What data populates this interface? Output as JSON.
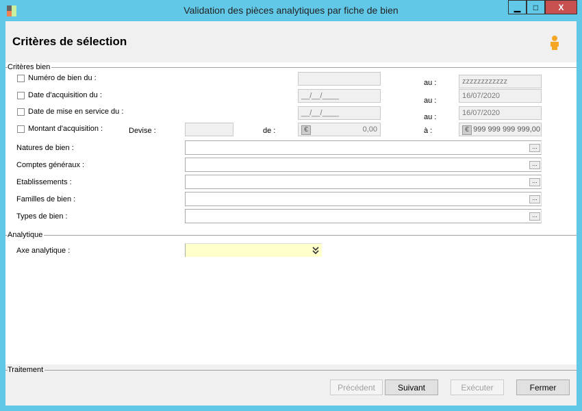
{
  "window": {
    "title": "Validation des pièces analytiques par fiche de bien",
    "minimize": "▁",
    "maximize": "□",
    "close": "X"
  },
  "header": {
    "title": "Critères de sélection",
    "icon": "user-icon"
  },
  "criteres_bien": {
    "group_label": "Critères bien",
    "numero": {
      "label": "Numéro de bien du :",
      "from": "",
      "to_label": "au :",
      "to": "zzzzzzzzzzzz",
      "checked": false
    },
    "date_acq": {
      "label": "Date d'acquisition du :",
      "from": "__/__/____",
      "to_label": "au :",
      "to": "16/07/2020",
      "checked": false
    },
    "date_service": {
      "label": "Date de mise en service du :",
      "from": "__/__/____",
      "to_label": "au :",
      "to": "16/07/2020",
      "checked": false
    },
    "montant": {
      "label": "Montant d'acquisition :",
      "devise_label": "Devise :",
      "devise": "",
      "from_label": "de :",
      "from": "0,00",
      "to_label": "à :",
      "to": "999 999 999 999,00",
      "currency": "€",
      "checked": false
    },
    "lookups": [
      {
        "label": "Natures de bien :",
        "value": ""
      },
      {
        "label": "Comptes généraux :",
        "value": ""
      },
      {
        "label": "Etablissements :",
        "value": ""
      },
      {
        "label": "Familles de bien :",
        "value": ""
      },
      {
        "label": "Types de bien :",
        "value": ""
      }
    ],
    "lookup_button": "..."
  },
  "analytique": {
    "group_label": "Analytique",
    "axe_label": "Axe analytique :",
    "axe_value": "",
    "field_color": "#ffffcc"
  },
  "traitement": {
    "group_label": "Traitement",
    "buttons": {
      "precedent": "Précédent",
      "suivant": "Suivant",
      "executer": "Exécuter",
      "fermer": "Fermer"
    }
  }
}
